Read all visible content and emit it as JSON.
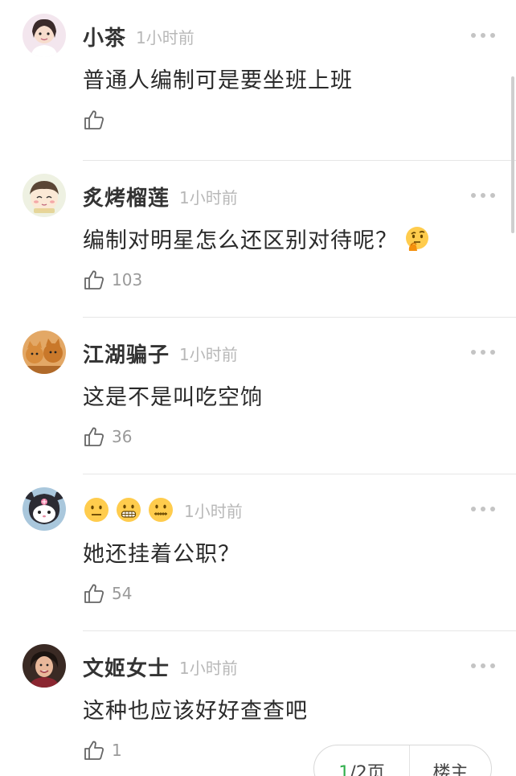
{
  "comments": [
    {
      "username": "小茶",
      "time": "1小时前",
      "content": "普通人编制可是要坐班上班",
      "likes": "",
      "avatar_icon": "girl-avatar-icon"
    },
    {
      "username": "炙烤榴莲",
      "time": "1小时前",
      "content": "编制对明星怎么还区别对待呢？",
      "content_emoji": "thinking-face-emoji",
      "likes": "103",
      "avatar_icon": "cartoon-avatar-icon"
    },
    {
      "username": "江湖骗子",
      "time": "1小时前",
      "content": "这是不是叫吃空饷",
      "likes": "36",
      "avatar_icon": "cats-avatar-icon"
    },
    {
      "username_emojis": [
        "neutral-face-emoji",
        "grimacing-face-emoji",
        "zipper-mouth-face-emoji"
      ],
      "time": "1小时前",
      "content": "她还挂着公职？",
      "likes": "54",
      "avatar_icon": "kuromi-avatar-icon"
    },
    {
      "username": "文姬女士",
      "time": "1小时前",
      "content": "这种也应该好好查查吧",
      "likes": "1",
      "avatar_icon": "woman-avatar-icon"
    }
  ],
  "pager": {
    "current": "1",
    "total_suffix": "/2页",
    "op_label": "楼主"
  },
  "colors": {
    "accent": "#2fae4b",
    "time": "#b8b8b8",
    "divider": "#e6e6e6"
  }
}
